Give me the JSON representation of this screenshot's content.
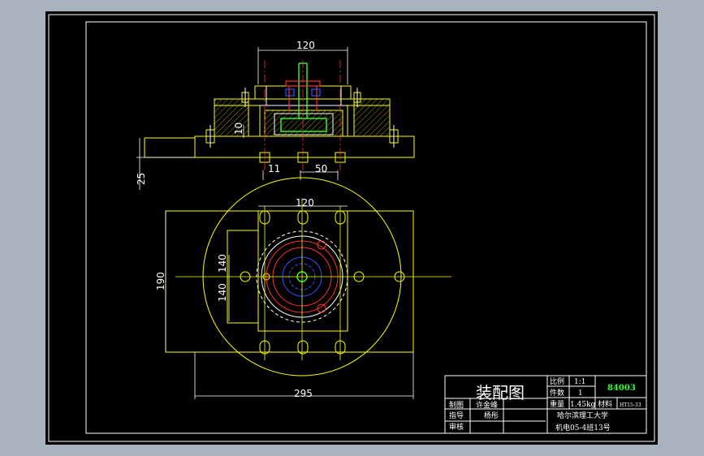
{
  "colors": {
    "background": "#a9b2bf",
    "paper": "#000000",
    "yellow": "#ffff00",
    "white": "#ffffff",
    "red": "#ff3030",
    "blue": "#3050ff",
    "green": "#33ff33"
  },
  "dimensions": {
    "top_width": "120",
    "height_10": "10",
    "height_25": "25",
    "spacing_11": "11",
    "spacing_50": "50",
    "plan_width_120": "120",
    "plan_140_a": "140",
    "plan_140_b": "140",
    "plan_190": "190",
    "plan_295": "295"
  },
  "title_block": {
    "drawing_title": "装配图",
    "scale_label": "比例",
    "scale_value": "1:1",
    "count_label": "件数",
    "count_value": "1",
    "weight_label": "重量",
    "weight_value": "1.45kg",
    "material_label": "材料",
    "material_value": "HT15-33",
    "drawing_number": "84003",
    "drawn_label": "制图",
    "drawn_name": "许金峰",
    "guide_label": "指导",
    "guide_name": "杨彤",
    "review_label": "审核",
    "school": "哈尔滨理工大学",
    "class": "机电05-4班13号"
  }
}
